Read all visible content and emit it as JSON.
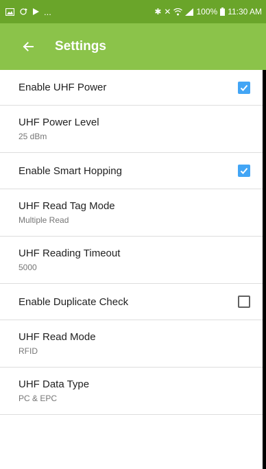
{
  "status_bar": {
    "left_dots": "...",
    "battery_percent": "100%",
    "time": "11:30 AM",
    "icons": [
      "image-icon",
      "sync-icon",
      "play-store-icon",
      "bluetooth-icon",
      "mute-icon",
      "wifi-icon",
      "signal-icon",
      "battery-icon"
    ]
  },
  "app_bar": {
    "title": "Settings",
    "back_icon": "arrow-back-icon",
    "background": "#8bc34a"
  },
  "settings": [
    {
      "title": "Enable UHF Power",
      "checkbox": true,
      "checked": true
    },
    {
      "title": "UHF Power Level",
      "summary": "25 dBm"
    },
    {
      "title": "Enable Smart Hopping",
      "checkbox": true,
      "checked": true
    },
    {
      "title": "UHF Read Tag Mode",
      "summary": "Multiple Read"
    },
    {
      "title": "UHF Reading Timeout",
      "summary": "5000"
    },
    {
      "title": "Enable Duplicate Check",
      "checkbox": true,
      "checked": false
    },
    {
      "title": "UHF Read Mode",
      "summary": "RFID"
    },
    {
      "title": "UHF Data Type",
      "summary": "PC & EPC"
    }
  ],
  "colors": {
    "status_bar": "#6aa52a",
    "checkbox_checked": "#42a5f5"
  }
}
